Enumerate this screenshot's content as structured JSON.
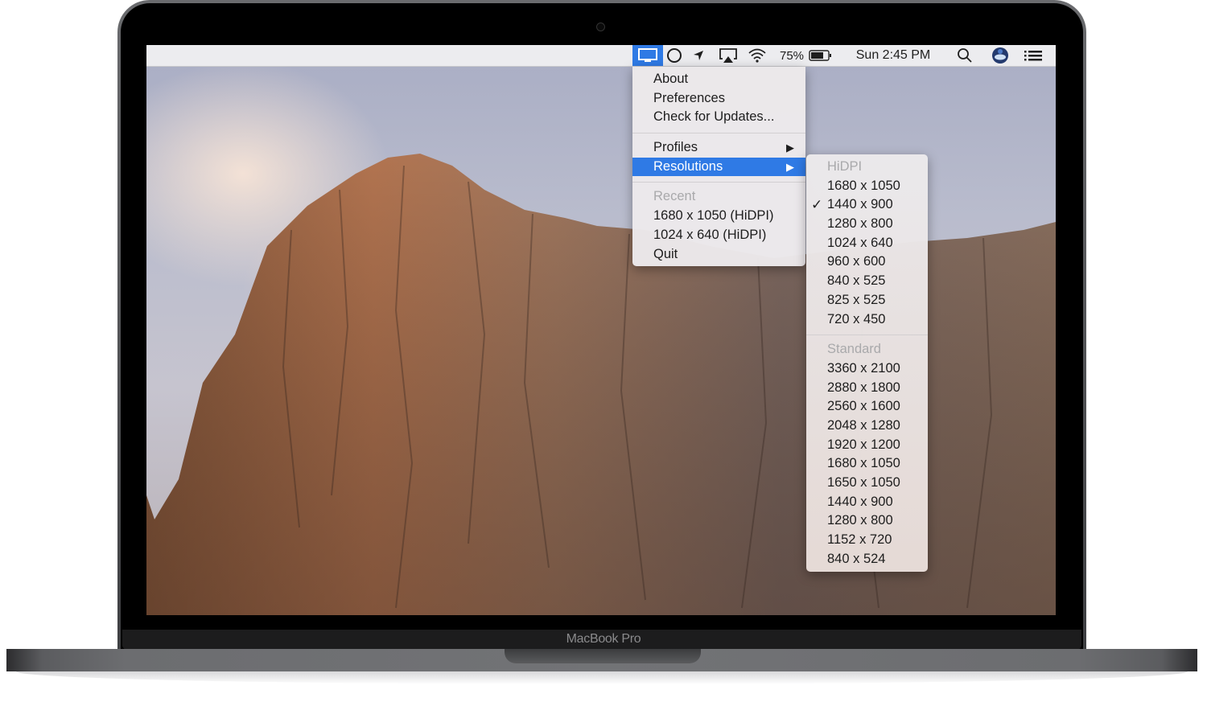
{
  "device": {
    "brand_label": "MacBook Pro"
  },
  "menubar": {
    "status_items": [
      {
        "name": "display-menu-icon",
        "active": true
      },
      {
        "name": "circle-icon"
      },
      {
        "name": "location-arrow-icon"
      },
      {
        "name": "airplay-icon"
      },
      {
        "name": "wifi-icon"
      }
    ],
    "battery_percent": "75%",
    "battery_level": 0.75,
    "clock": "Sun 2:45 PM",
    "accent_color": "#2f7ae5"
  },
  "main_menu": {
    "items": [
      {
        "label": "About"
      },
      {
        "label": "Preferences"
      },
      {
        "label": "Check for Updates..."
      }
    ],
    "submenu_items": [
      {
        "label": "Profiles",
        "arrow": "▶"
      },
      {
        "label": "Resolutions",
        "arrow": "▶",
        "selected": true
      }
    ],
    "recent_header": "Recent",
    "recent_items": [
      {
        "label": "1680 x 1050 (HiDPI)"
      },
      {
        "label": "1024 x 640 (HiDPI)"
      }
    ],
    "quit_label": "Quit"
  },
  "resolutions_menu": {
    "hidpi_header": "HiDPI",
    "hidpi": [
      {
        "label": "1680 x 1050",
        "checked": false
      },
      {
        "label": "1440 x 900",
        "checked": true
      },
      {
        "label": "1280 x 800",
        "checked": false
      },
      {
        "label": "1024 x 640",
        "checked": false
      },
      {
        "label": "960 x 600",
        "checked": false
      },
      {
        "label": "840 x 525",
        "checked": false
      },
      {
        "label": "825 x 525",
        "checked": false
      },
      {
        "label": "720 x 450",
        "checked": false
      }
    ],
    "standard_header": "Standard",
    "standard": [
      {
        "label": "3360 x 2100"
      },
      {
        "label": "2880 x 1800"
      },
      {
        "label": "2560 x 1600"
      },
      {
        "label": "2048 x 1280"
      },
      {
        "label": "1920 x 1200"
      },
      {
        "label": "1680 x 1050"
      },
      {
        "label": "1650 x 1050"
      },
      {
        "label": "1440 x 900"
      },
      {
        "label": "1280 x 800"
      },
      {
        "label": "1152 x 720"
      },
      {
        "label": "840 x 524"
      }
    ],
    "check_glyph": "✓"
  }
}
